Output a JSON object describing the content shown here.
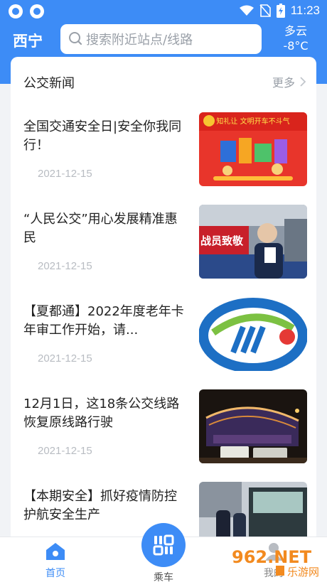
{
  "status_bar": {
    "time": "11:23"
  },
  "header": {
    "city": "西宁",
    "search_placeholder": "搜索附近站点/线路",
    "weather_condition": "多云",
    "weather_temp": "-8°C"
  },
  "news": {
    "section_title": "公交新闻",
    "more_label": "更多",
    "items": [
      {
        "title": "全国交通安全日|安全你我同行！",
        "date": "2021-12-15",
        "thumb_caption": "知礼让 文明开车不斗气"
      },
      {
        "title": "“人民公交”用心发展精准惠民",
        "date": "2021-12-15",
        "thumb_caption": "战员致敬"
      },
      {
        "title": "【夏都通】2022年度老年卡年审工作开始，请...",
        "date": "2021-12-15",
        "thumb_caption": ""
      },
      {
        "title": "12月1日，这18条公交线路恢复原线路行驶",
        "date": "2021-12-15",
        "thumb_caption": ""
      },
      {
        "title": "【本期安全】抓好疫情防控 护航安全生产",
        "date": "",
        "thumb_caption": ""
      }
    ]
  },
  "bottom_nav": {
    "home_label": "首页",
    "ride_label": "乘车",
    "mine_label": "我的"
  },
  "watermark": {
    "text": "962.NET",
    "subtext": "乐游网"
  },
  "colors": {
    "primary": "#3d8cf6",
    "background": "#f1f3f6",
    "date_gray": "#b8bcc2"
  },
  "icons": [
    "app-icon",
    "wifi-icon",
    "no-sim-icon",
    "battery-icon",
    "search-icon",
    "chevron-right-icon",
    "home-icon",
    "qr-scan-icon",
    "user-icon"
  ]
}
